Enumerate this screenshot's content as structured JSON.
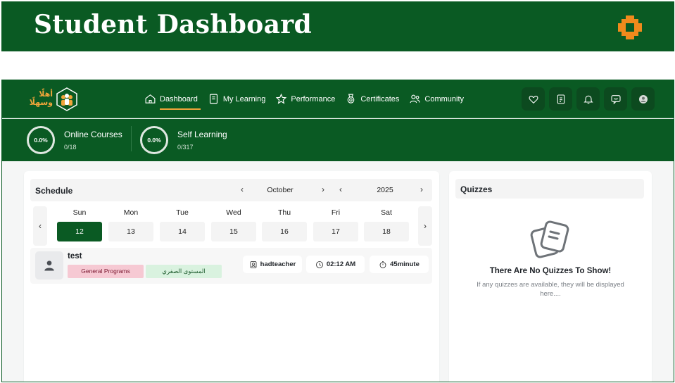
{
  "banner": {
    "title": "Student Dashboard"
  },
  "brand": {
    "text_line1": "أهلًا",
    "text_line2": "وسهلًا"
  },
  "nav": {
    "items": [
      {
        "label": "Dashboard",
        "icon": "home-icon",
        "active": true
      },
      {
        "label": "My Learning",
        "icon": "book-icon",
        "active": false
      },
      {
        "label": "Performance",
        "icon": "star-icon",
        "active": false
      },
      {
        "label": "Certificates",
        "icon": "medal-icon",
        "active": false
      },
      {
        "label": "Community",
        "icon": "users-icon",
        "active": false
      }
    ],
    "icon_buttons": [
      "heart-icon",
      "document-icon",
      "bell-icon",
      "chat-icon",
      "profile-icon"
    ]
  },
  "progress": {
    "online": {
      "percent": "0.0%",
      "title": "Online Courses",
      "count": "0/18"
    },
    "self": {
      "percent": "0.0%",
      "title": "Self Learning",
      "count": "0/317"
    }
  },
  "schedule": {
    "title": "Schedule",
    "month": "October",
    "year": "2025",
    "days": [
      {
        "name": "Sun",
        "num": "12",
        "selected": true
      },
      {
        "name": "Mon",
        "num": "13",
        "selected": false
      },
      {
        "name": "Tue",
        "num": "14",
        "selected": false
      },
      {
        "name": "Wed",
        "num": "15",
        "selected": false
      },
      {
        "name": "Thu",
        "num": "16",
        "selected": false
      },
      {
        "name": "Fri",
        "num": "17",
        "selected": false
      },
      {
        "name": "Sat",
        "num": "18",
        "selected": false
      }
    ],
    "event": {
      "title": "test",
      "tag1": "General Programs",
      "tag2": "المستوى الصفري",
      "teacher": "hadteacher",
      "time": "02:12 AM",
      "duration": "45minute"
    }
  },
  "quizzes": {
    "title": "Quizzes",
    "empty_title": "There Are No Quizzes To Show!",
    "empty_sub": "If any quizzes are available, they will be displayed here...."
  },
  "colors": {
    "brand_green": "#0a5a23",
    "accent_orange": "#f0a53a",
    "tag_pink": "#f6c9d3",
    "tag_green": "#d9f2df"
  }
}
